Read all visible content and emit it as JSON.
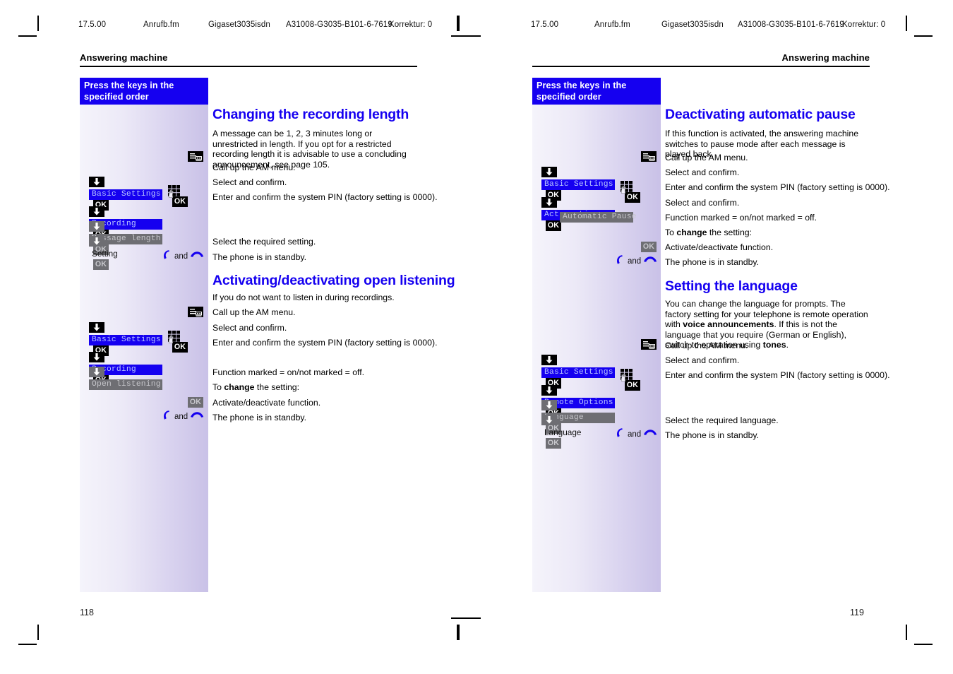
{
  "document": {
    "slug_left": {
      "date": "17.5.00",
      "file": "Anrufb.fm",
      "product": "Gigaset3035isdn",
      "docid": "A31008-G3035-B101-6-7619",
      "korrektur": "Korrektur: 0"
    },
    "slug_right": {
      "date": "17.5.00",
      "file": "Anrufb.fm",
      "product": "Gigaset3035isdn",
      "docid": "A31008-G3035-B101-6-7619",
      "korrektur": "Korrektur: 0"
    },
    "colors": {
      "accent_blue": "#1500f0",
      "key_black": "#000000",
      "key_grey": "#6e6e73",
      "band_start": "#f5f4fb",
      "band_end": "#c9c1e7"
    }
  },
  "left_page": {
    "running_head": "Answering machine",
    "page_number": "118",
    "key_column_title": "Press the keys in the\nspecified order",
    "section1": {
      "heading": "Changing the recording length",
      "intro": "A message can be 1, 2, 3 minutes long or unrestricted in length. If you opt for a restricted recording length it is advisable to use a concluding announcement, see page 105.",
      "steps": [
        {
          "key": "am-menu",
          "label": "",
          "ok": null,
          "text": "Call up the AM menu."
        },
        {
          "key": "arrow",
          "label": "Basic Settings",
          "ok": "on",
          "text": "Select and confirm.",
          "state": "sel"
        },
        {
          "key": "keypad",
          "label": "",
          "ok": "on",
          "text": "Enter and confirm the system PIN (factory setting is 0000)."
        },
        {
          "key": "arrow",
          "label": "Recording",
          "ok": "on",
          "text": "",
          "state": "sel"
        },
        {
          "key": "arrow-off",
          "label": "Message length",
          "ok": "off",
          "text": "",
          "state": "dim"
        },
        {
          "key": "arrow-off",
          "label": "Setting",
          "ok": "off",
          "text": "Select the required setting.",
          "state": "plain"
        },
        {
          "key": "handset",
          "label": "and",
          "ok": null,
          "text": "The phone is in standby."
        }
      ]
    },
    "section2": {
      "heading": "Activating/deactivating open listening",
      "intro": "If you do not want to listen in during recordings.",
      "steps": [
        {
          "key": "am-menu",
          "label": "",
          "ok": null,
          "text": "Call up the AM menu."
        },
        {
          "key": "arrow",
          "label": "Basic Settings",
          "ok": "on",
          "text": "Select and confirm.",
          "state": "sel"
        },
        {
          "key": "keypad",
          "label": "",
          "ok": "on",
          "text": "Enter and confirm the system PIN (factory setting is 0000)."
        },
        {
          "key": "arrow",
          "label": "Recording",
          "ok": "on",
          "text": "",
          "state": "sel"
        },
        {
          "key": "arrow-off",
          "label": "Open listening",
          "ok": null,
          "text": "",
          "state": "dim"
        }
      ],
      "notes": [
        "Function marked = on/not marked = off.",
        "To change the setting:"
      ],
      "note_bold": "change",
      "tail": [
        {
          "key": "ok-off",
          "text": "Activate/deactivate function."
        },
        {
          "key": "handset",
          "label": "and",
          "text": "The phone is in standby."
        }
      ]
    }
  },
  "right_page": {
    "running_head": "Answering machine",
    "page_number": "119",
    "key_column_title": "Press the keys in the\nspecified order",
    "section1": {
      "heading": "Deactivating automatic pause",
      "intro": "If this function is activated, the answering machine switches to pause mode after each message is played back.",
      "steps": [
        {
          "key": "am-menu",
          "label": "",
          "ok": null,
          "text": "Call up the AM menu."
        },
        {
          "key": "arrow",
          "label": "Basic Settings",
          "ok": "on",
          "text": "Select and confirm.",
          "state": "sel"
        },
        {
          "key": "keypad",
          "label": "",
          "ok": "on",
          "text": "Enter and confirm the system PIN (factory setting is 0000)."
        },
        {
          "key": "arrow",
          "label": "Act. option",
          "ok": "on",
          "text": "Select and confirm.",
          "state": "sel"
        },
        {
          "key": "none",
          "label": "Automatic Pause",
          "ok": null,
          "text": "",
          "state": "dim"
        }
      ],
      "notes": [
        "Function marked = on/not marked = off.",
        "To change the setting:"
      ],
      "note_bold": "change",
      "tail": [
        {
          "key": "ok-off",
          "text": "Activate/deactivate function."
        },
        {
          "key": "handset",
          "label": "and",
          "text": "The phone is in standby."
        }
      ]
    },
    "section2": {
      "heading": "Setting the language",
      "intro_parts": [
        {
          "t": "You can change the language for prompts. The factory setting for your telephone is remote operation with ",
          "b": false
        },
        {
          "t": "voice announcements",
          "b": true
        },
        {
          "t": ". If this is not the language that you require (German or English), switch to operation using ",
          "b": false
        },
        {
          "t": "tones",
          "b": true
        },
        {
          "t": ".",
          "b": false
        }
      ],
      "steps": [
        {
          "key": "am-menu",
          "label": "",
          "ok": null,
          "text": "Call up the AM menu."
        },
        {
          "key": "arrow",
          "label": "Basic Settings",
          "ok": "on",
          "text": "Select and confirm.",
          "state": "sel"
        },
        {
          "key": "keypad",
          "label": "",
          "ok": "on",
          "text": "Enter and confirm the system PIN (factory setting is 0000)."
        },
        {
          "key": "arrow",
          "label": "Remote Options",
          "ok": "on",
          "text": "",
          "state": "sel"
        },
        {
          "key": "arrow-off",
          "label": "Language",
          "ok": "off",
          "text": "",
          "state": "dim"
        },
        {
          "key": "arrow-off",
          "label": "Language",
          "ok": "off",
          "text": "Select the required language.",
          "state": "plain"
        },
        {
          "key": "handset",
          "label": "and",
          "ok": null,
          "text": "The phone is in standby."
        }
      ]
    }
  },
  "icons": {
    "am_menu": "am-menu-cassette-icon",
    "keypad": "keypad-hand-icon",
    "arrow_down": "arrow-down-icon",
    "ok": "ok-key",
    "handset_pickup": "handset-pickup-icon",
    "handset_hangup": "handset-hangup-icon"
  }
}
